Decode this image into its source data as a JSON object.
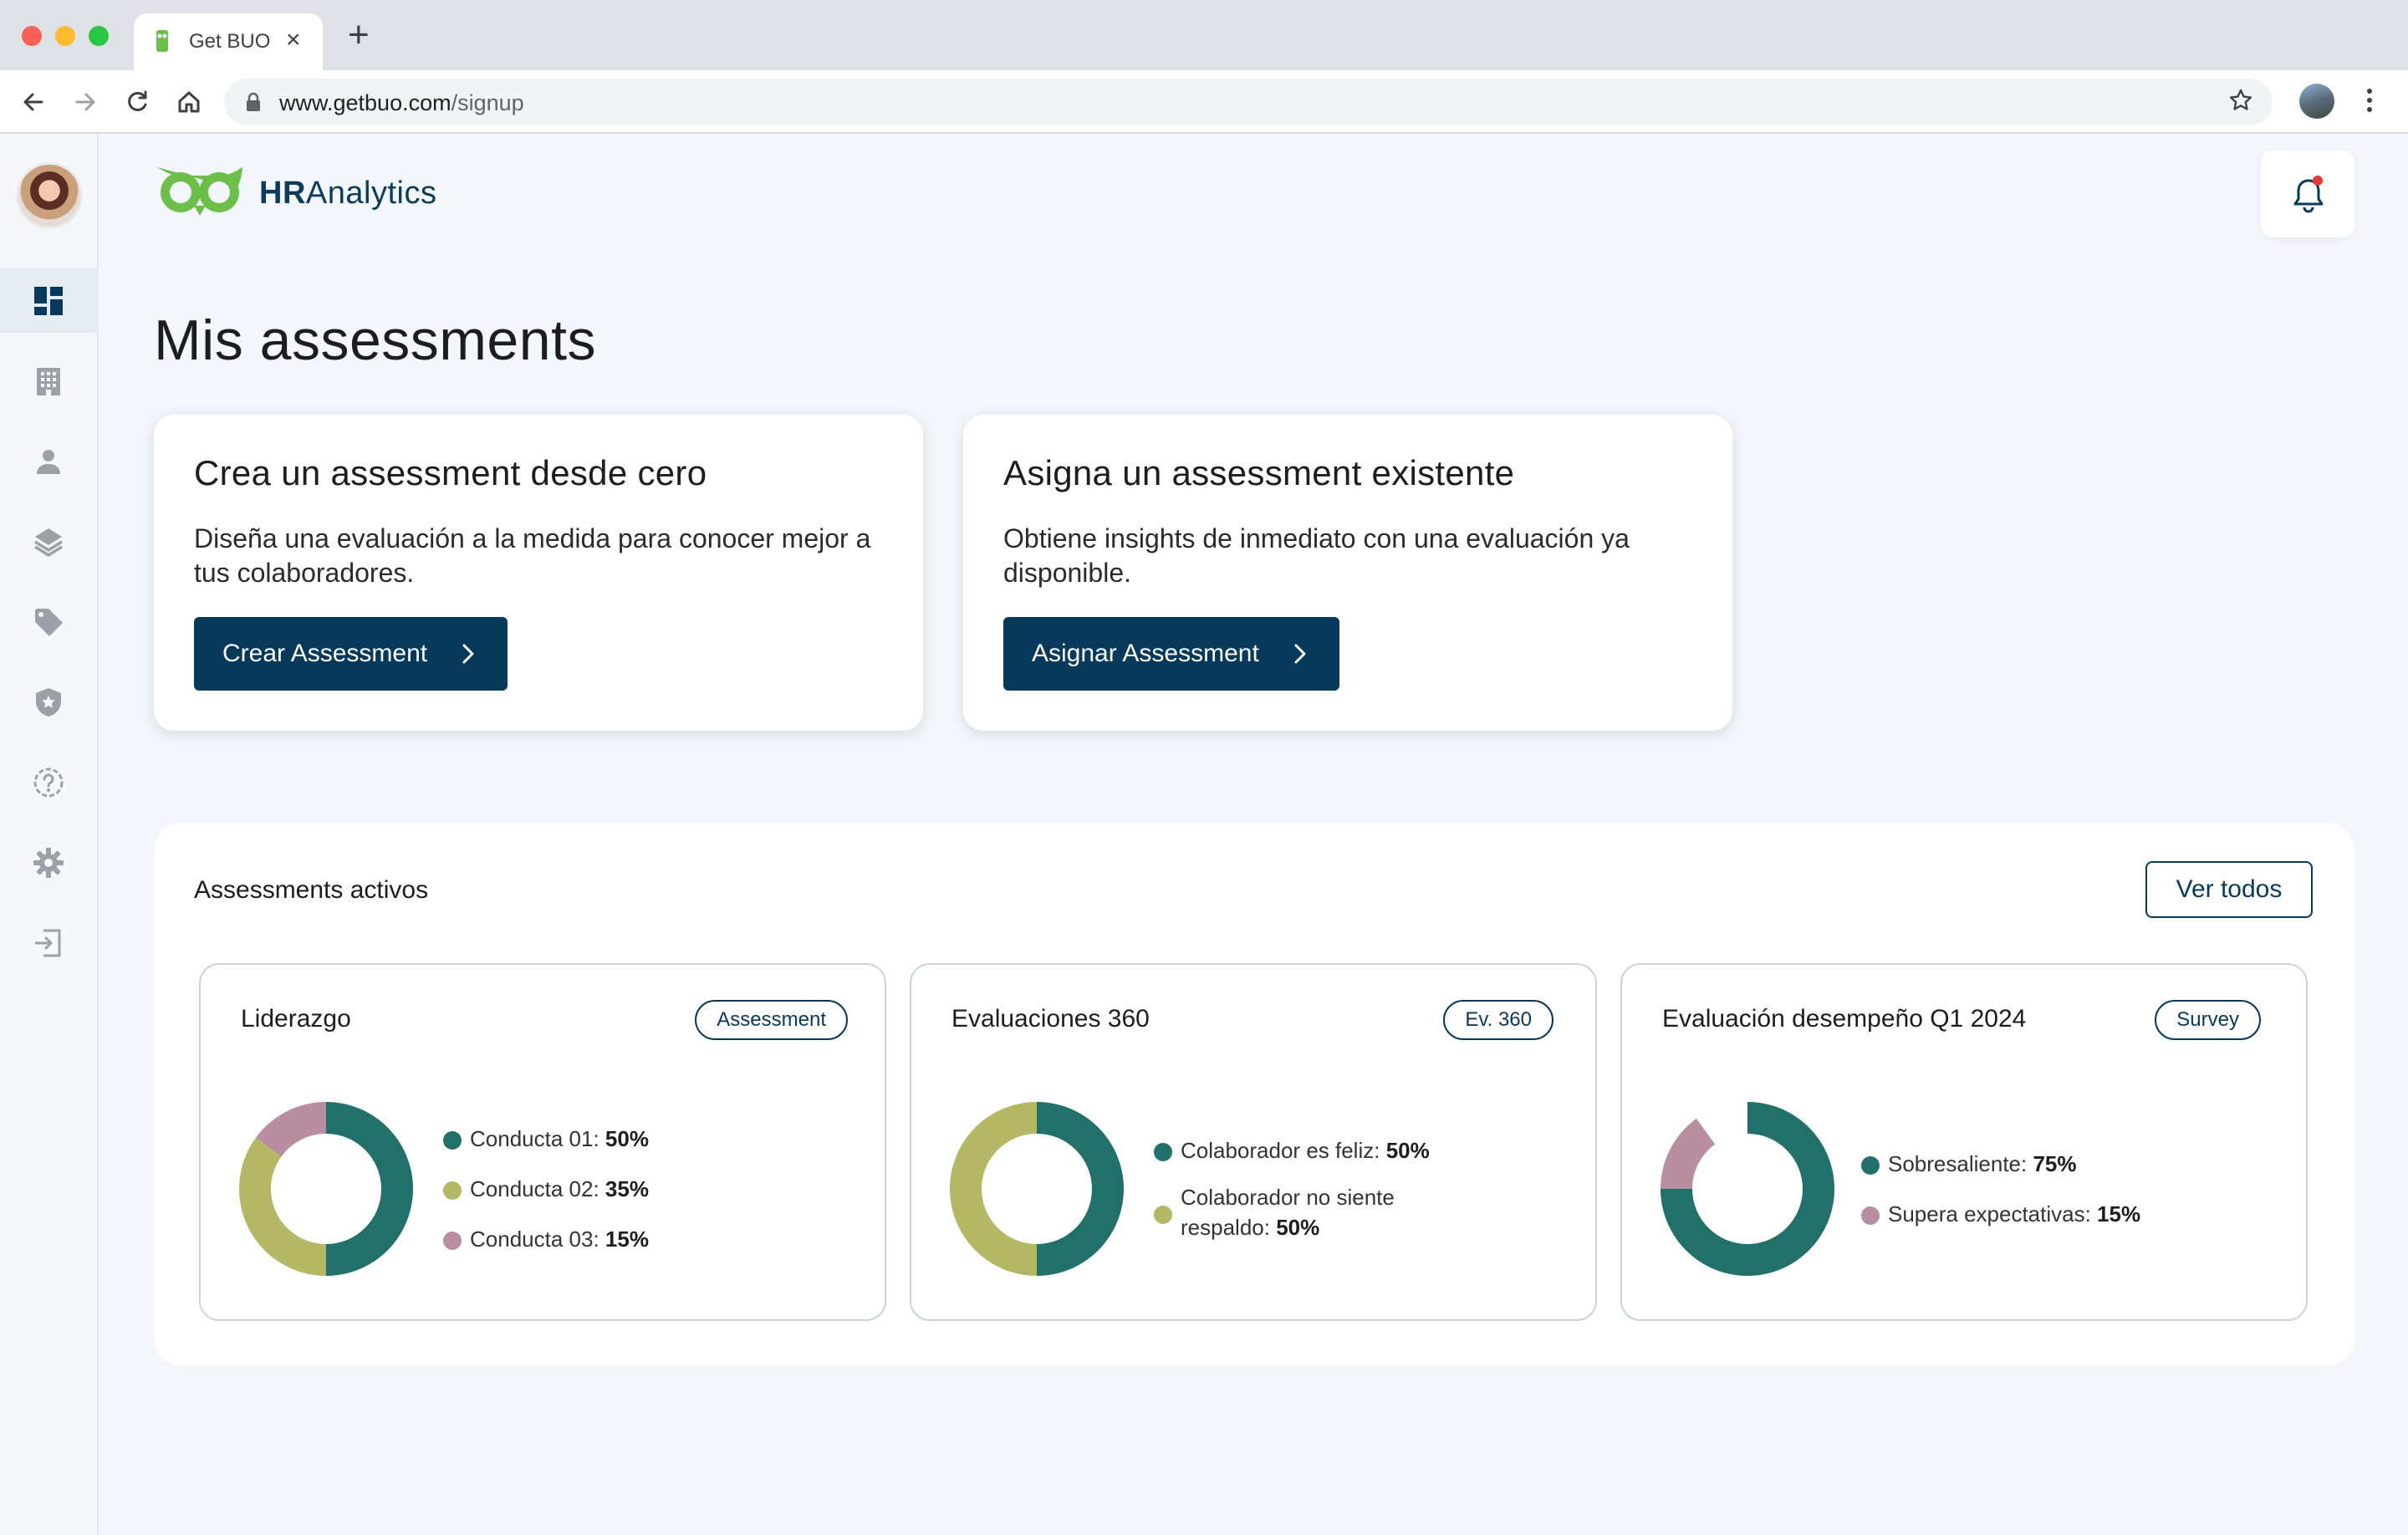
{
  "browser": {
    "tab_title": "Get BUO",
    "url_host": "www.getbuo.com",
    "url_path": "/signup"
  },
  "header": {
    "brand_bold": "HR",
    "brand_rest": "Analytics"
  },
  "page": {
    "title": "Mis assessments"
  },
  "actions": [
    {
      "title": "Crea un assessment desde cero",
      "description": "Diseña una evaluación a la medida para conocer mejor a tus colaboradores.",
      "button": "Crear Assessment"
    },
    {
      "title": "Asigna un assessment existente",
      "description": "Obtiene insights de inmediato con una evaluación ya disponible.",
      "button": "Asignar Assessment"
    }
  ],
  "active": {
    "title": "Assessments activos",
    "view_all": "Ver todos",
    "cards": [
      {
        "name": "Liderazgo",
        "badge": "Assessment",
        "legend": [
          {
            "label": "Conducta 01:",
            "value": "50%"
          },
          {
            "label": "Conducta 02:",
            "value": "35%"
          },
          {
            "label": "Conducta 03:",
            "value": "15%"
          }
        ]
      },
      {
        "name": "Evaluaciones 360",
        "badge": "Ev. 360",
        "legend": [
          {
            "label": "Colaborador es feliz:",
            "value": "50%"
          },
          {
            "label": "Colaborador no siente respaldo:",
            "value": "50%"
          }
        ]
      },
      {
        "name": "Evaluación desempeño Q1 2024",
        "badge": "Survey",
        "legend": [
          {
            "label": "Sobresaliente:",
            "value": "75%"
          },
          {
            "label": "Supera expectativas:",
            "value": "15%"
          }
        ]
      }
    ]
  },
  "chart_data": [
    {
      "type": "pie",
      "categories": [
        "Conducta 01",
        "Conducta 02",
        "Conducta 03"
      ],
      "values": [
        50,
        35,
        15
      ],
      "colors": [
        "#21706a",
        "#b4b763",
        "#b88ea0"
      ]
    },
    {
      "type": "pie",
      "categories": [
        "Colaborador es feliz",
        "Colaborador no siente respaldo"
      ],
      "values": [
        50,
        50
      ],
      "colors": [
        "#21706a",
        "#b4b763"
      ]
    },
    {
      "type": "pie",
      "categories": [
        "Sobresaliente",
        "Supera expectativas"
      ],
      "values": [
        75,
        15
      ],
      "colors": [
        "#21706a",
        "#b88ea0"
      ]
    }
  ],
  "colors": {
    "primary": "#073a5a",
    "teal": "#21706a",
    "olive": "#b4b763",
    "mauve": "#b88ea0",
    "logo_green": "#6cc04a"
  },
  "icons": {
    "sidebar": [
      "dashboard-icon",
      "building-icon",
      "user-icon",
      "layers-icon",
      "tag-icon",
      "shield-icon",
      "help-icon",
      "gear-icon",
      "logout-icon"
    ]
  }
}
